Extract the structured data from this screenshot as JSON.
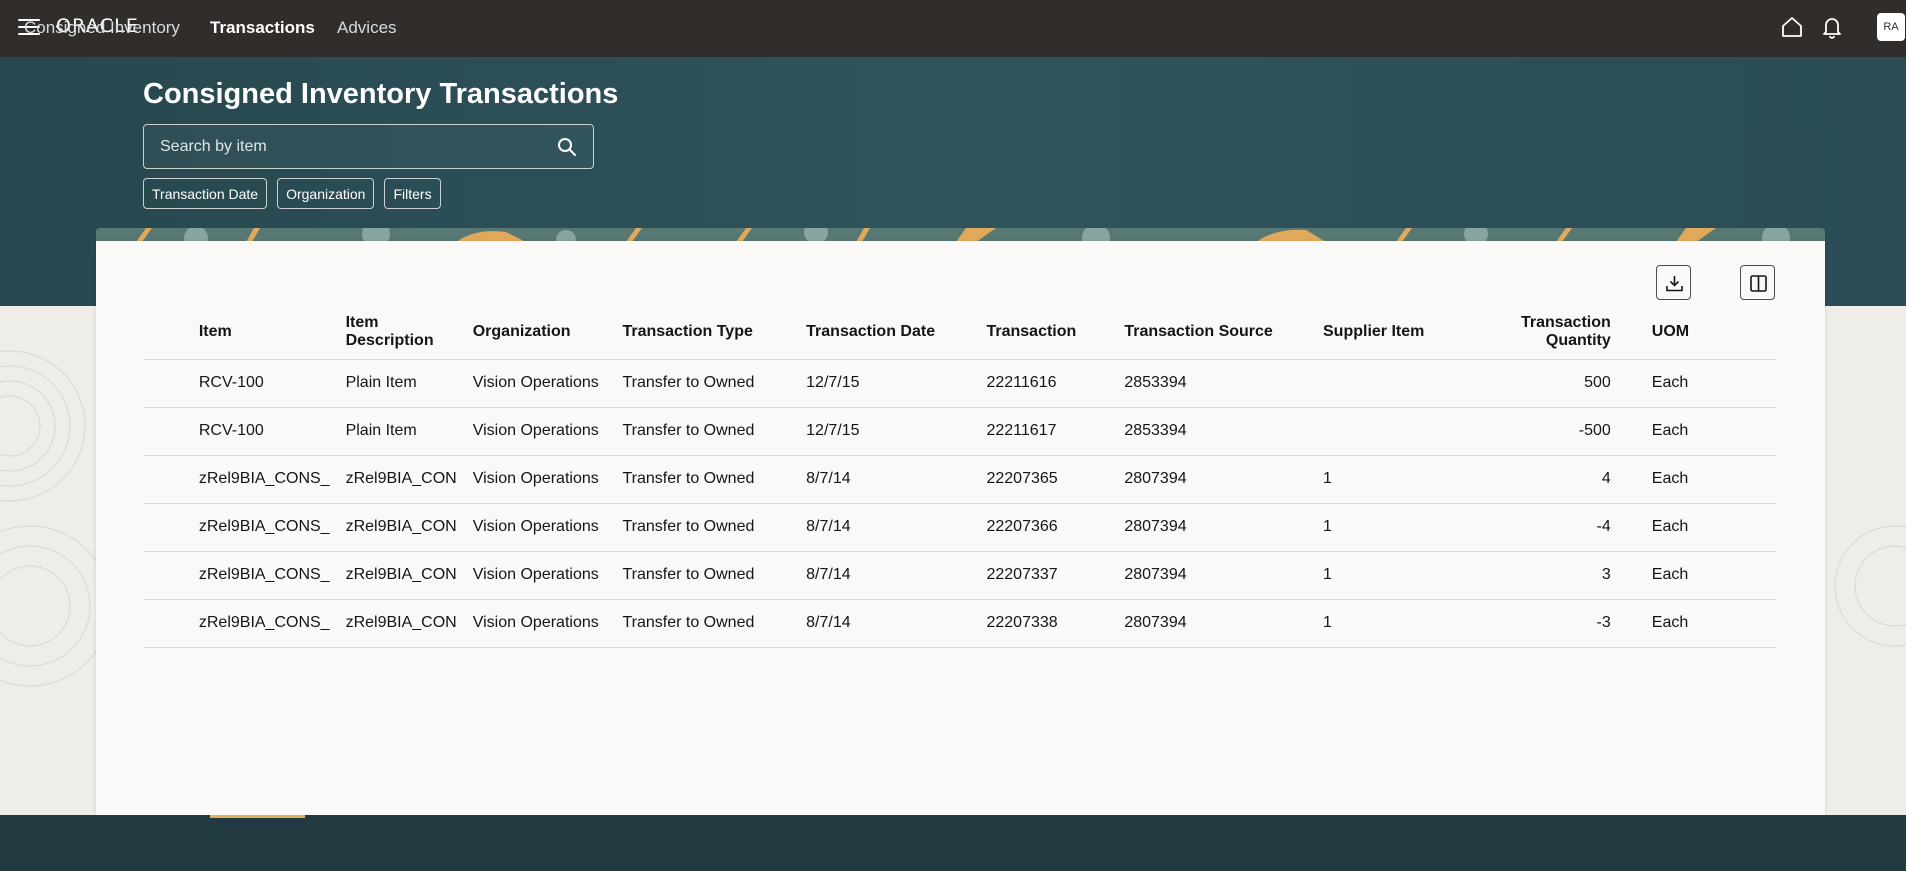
{
  "header": {
    "logo": "ORACLE",
    "avatar_initials": "RA"
  },
  "page": {
    "title": "Consigned Inventory Transactions"
  },
  "search": {
    "placeholder": "Search by item"
  },
  "filter_chips": [
    "Transaction Date",
    "Organization",
    "Filters"
  ],
  "table": {
    "columns": [
      "Item",
      "Item Description",
      "Organization",
      "Transaction Type",
      "Transaction Date",
      "Transaction",
      "Transaction Source",
      "Supplier Item",
      "Transaction Quantity",
      "UOM"
    ],
    "rows": [
      [
        "RCV-100",
        "Plain Item",
        "Vision Operations",
        "Transfer to Owned",
        "12/7/15",
        "22211616",
        "2853394",
        "",
        "500",
        "Each"
      ],
      [
        "RCV-100",
        "Plain Item",
        "Vision Operations",
        "Transfer to Owned",
        "12/7/15",
        "22211617",
        "2853394",
        "",
        "-500",
        "Each"
      ],
      [
        "zRel9BIA_CONS_",
        "zRel9BIA_CON",
        "Vision Operations",
        "Transfer to Owned",
        "8/7/14",
        "22207365",
        "2807394",
        "1",
        "4",
        "Each"
      ],
      [
        "zRel9BIA_CONS_",
        "zRel9BIA_CON",
        "Vision Operations",
        "Transfer to Owned",
        "8/7/14",
        "22207366",
        "2807394",
        "1",
        "-4",
        "Each"
      ],
      [
        "zRel9BIA_CONS_",
        "zRel9BIA_CON",
        "Vision Operations",
        "Transfer to Owned",
        "8/7/14",
        "22207337",
        "2807394",
        "1",
        "3",
        "Each"
      ],
      [
        "zRel9BIA_CONS_",
        "zRel9BIA_CON",
        "Vision Operations",
        "Transfer to Owned",
        "8/7/14",
        "22207338",
        "2807394",
        "1",
        "-3",
        "Each"
      ]
    ]
  },
  "bottom_tabs": [
    {
      "label": "Consigned Inventory",
      "active": false
    },
    {
      "label": "Transactions",
      "active": true
    },
    {
      "label": "Advices",
      "active": false
    }
  ],
  "icons": {
    "menu": "hamburger-icon",
    "home": "home-icon",
    "notifications": "bell-icon",
    "search": "search-icon",
    "export": "download-icon",
    "columns": "columns-icon"
  },
  "colors": {
    "topbar": "#312d2a",
    "hero": "#2f545c",
    "bottombar": "#223b43",
    "tab_accent": "#e4b15b"
  }
}
